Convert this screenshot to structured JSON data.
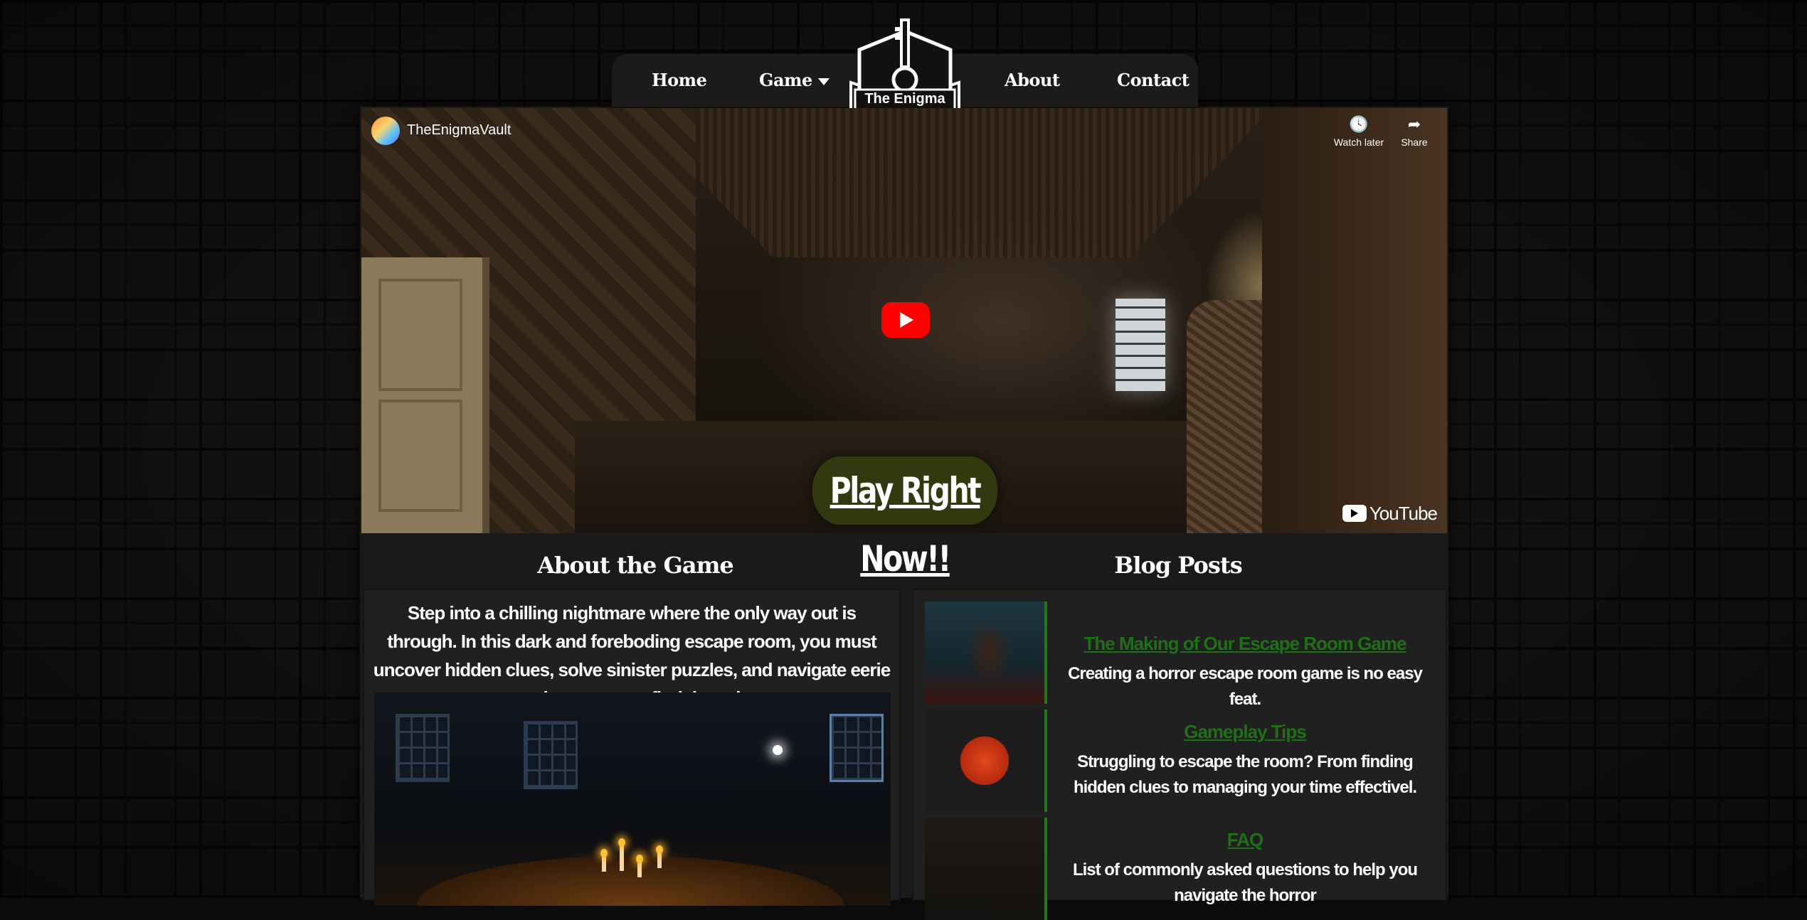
{
  "nav": {
    "home": "Home",
    "game": "Game",
    "about": "About",
    "contact": "Contact",
    "logo_text": "The Enigma Vault"
  },
  "video": {
    "channel_name": "TheEnigmaVault",
    "watch_later": "Watch later",
    "share": "Share",
    "brand": "YouTube"
  },
  "cta": {
    "play_now": "Play Right Now!!"
  },
  "about": {
    "title": "About the Game",
    "text": "Step into a chilling nightmare where the only way out is through. In this dark and foreboding escape room, you must uncover hidden clues, solve sinister puzzles, and navigate eerie environments to find the exit."
  },
  "blog": {
    "title": "Blog Posts",
    "posts": [
      {
        "title": "The Making of Our Escape Room Game",
        "desc": "Creating a horror escape room game is no easy feat."
      },
      {
        "title": "Gameplay Tips",
        "desc": "Struggling to escape the room? From finding hidden clues to managing your time effectivel."
      },
      {
        "title": "FAQ",
        "desc": "List of commonly asked questions to help you navigate the horror"
      }
    ]
  },
  "colors": {
    "link_green": "#1f6f17",
    "accent_green": "#1f7a16",
    "cta_bg": "#32390f",
    "yt_red": "#ff0000"
  },
  "icons": [
    "caret-down-icon",
    "key-logo-icon",
    "clock-icon",
    "share-icon",
    "play-icon",
    "youtube-icon"
  ]
}
